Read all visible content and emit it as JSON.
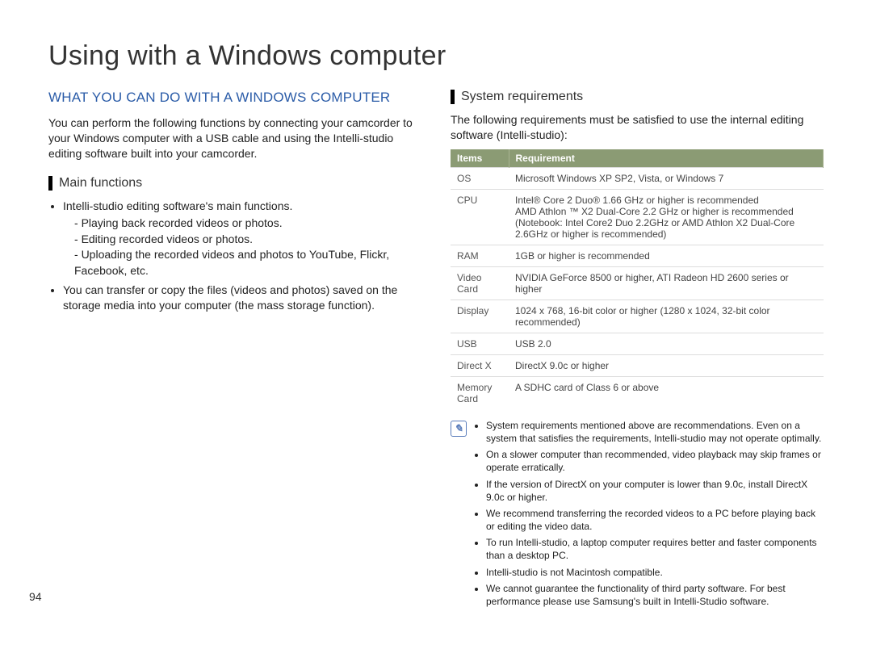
{
  "page_number": "94",
  "title": "Using with a Windows computer",
  "left": {
    "section_heading": "WHAT YOU CAN DO WITH A WINDOWS COMPUTER",
    "intro": "You can perform the following functions by connecting your camcorder to your Windows computer with a USB cable and using the Intelli-studio editing software built into your camcorder.",
    "sub_heading": "Main functions",
    "bullets": {
      "b1": "Intelli-studio editing software's main functions.",
      "b1_sub": {
        "s1": "Playing back recorded videos or photos.",
        "s2": "Editing recorded videos or photos.",
        "s3": "Uploading the recorded videos and photos to YouTube, Flickr, Facebook, etc."
      },
      "b2": "You can transfer or copy the files (videos and photos) saved on the storage media into your computer (the mass storage function)."
    }
  },
  "right": {
    "sub_heading": "System requirements",
    "intro": "The following requirements must be satisfied to use the internal editing software (Intelli-studio):",
    "table": {
      "header": {
        "items": "Items",
        "req": "Requirement"
      },
      "rows": [
        {
          "item": "OS",
          "req": "Microsoft Windows XP SP2, Vista, or Windows 7"
        },
        {
          "item": "CPU",
          "req": "Intel® Core 2 Duo® 1.66 GHz or higher is recommended\nAMD Athlon ™ X2 Dual-Core 2.2 GHz or higher is recommended\n(Notebook: Intel Core2 Duo 2.2GHz or AMD Athlon X2 Dual-Core 2.6GHz or higher is recommended)"
        },
        {
          "item": "RAM",
          "req": "1GB or higher is recommended"
        },
        {
          "item": "Video Card",
          "req": "NVIDIA GeForce 8500 or higher, ATI Radeon HD 2600 series or higher"
        },
        {
          "item": "Display",
          "req": "1024 x 768, 16-bit color or higher (1280 x 1024, 32-bit color recommended)"
        },
        {
          "item": "USB",
          "req": "USB 2.0"
        },
        {
          "item": "Direct X",
          "req": "DirectX 9.0c or higher"
        },
        {
          "item": "Memory Card",
          "req": "A SDHC card of Class 6 or above"
        }
      ]
    },
    "notes": [
      "System requirements mentioned above are recommendations. Even on a system that satisfies the requirements, Intelli-studio may not operate optimally.",
      "On a slower computer than recommended, video playback may skip frames or operate erratically.",
      "If the version of DirectX on your computer is lower than 9.0c, install DirectX 9.0c or higher.",
      "We recommend transferring the recorded videos to a PC before playing back or editing the video data.",
      "To run Intelli-studio, a laptop computer requires better and faster components than a desktop PC.",
      "Intelli-studio is not Macintosh compatible.",
      "We cannot guarantee the functionality of third party software. For best performance please use Samsung's built in Intelli-Studio software."
    ]
  }
}
